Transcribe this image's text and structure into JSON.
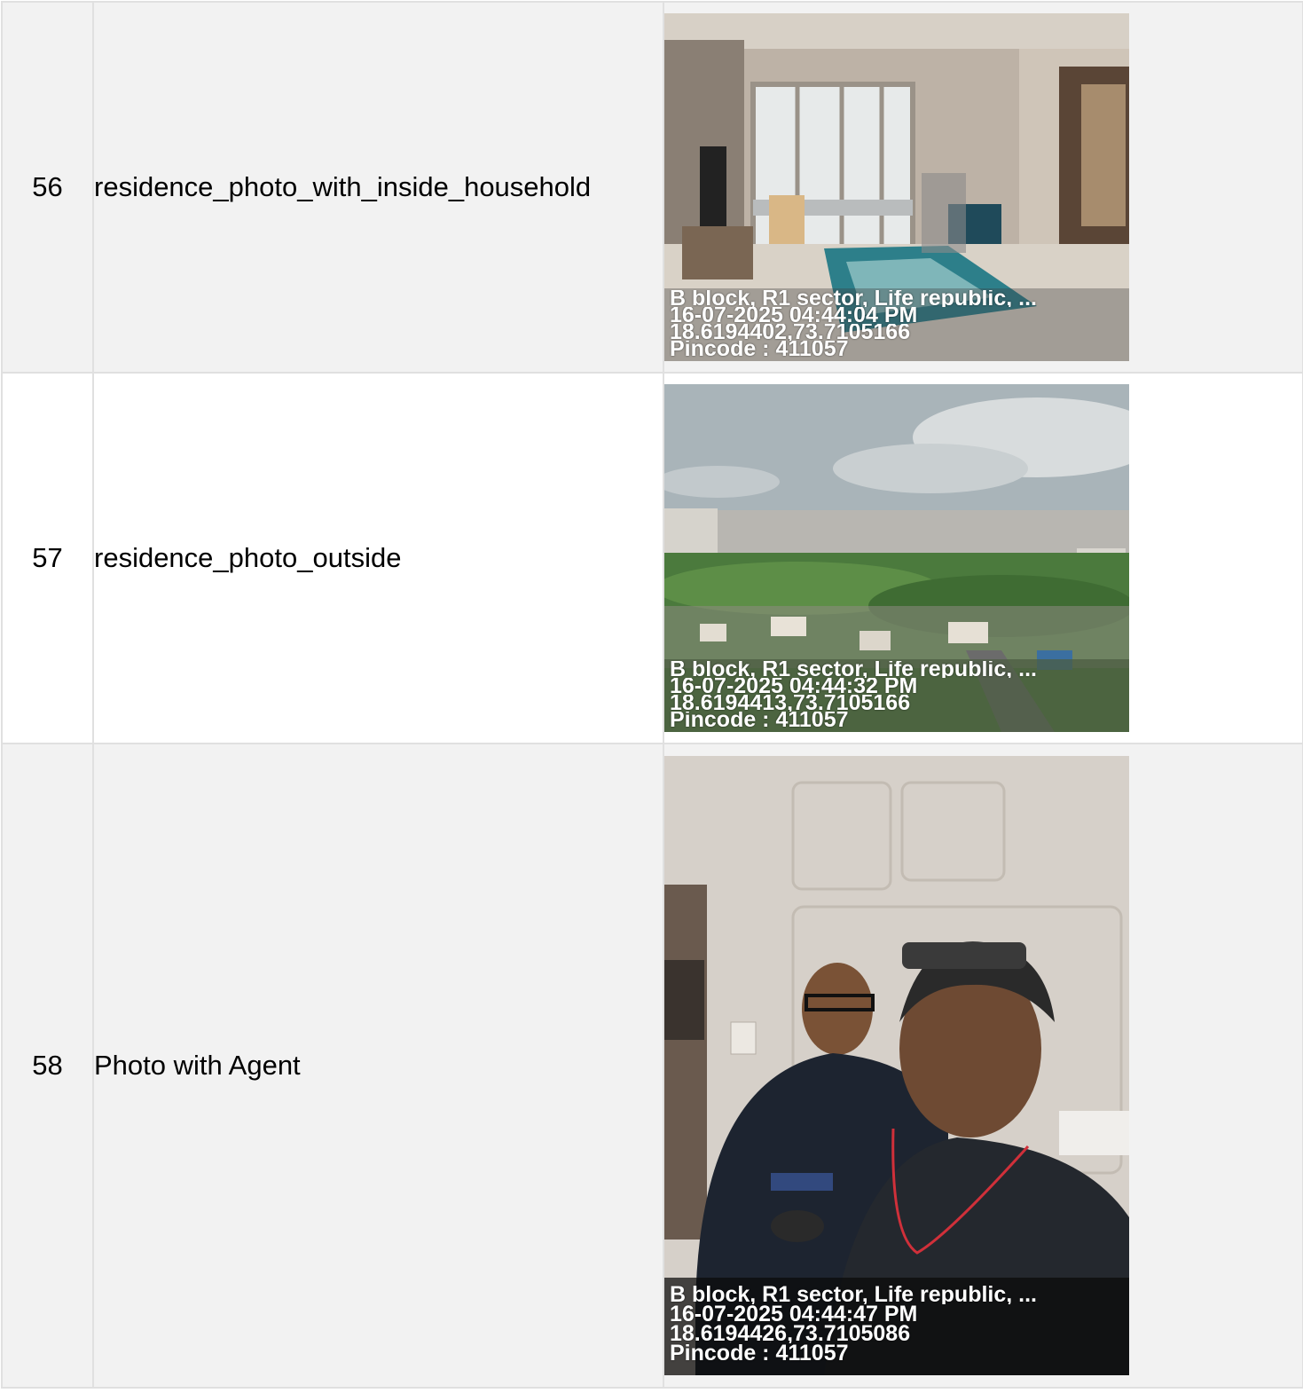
{
  "rows": [
    {
      "index": "56",
      "name": "residence_photo_with_inside_household",
      "photo_icon": "living-room-photo",
      "stamp": {
        "address": "B block, R1 sector, Life republic, ...",
        "datetime": "16-07-2025 04:44:04 PM",
        "coords": "18.6194402,73.7105166",
        "pincode": "Pincode : 411057"
      }
    },
    {
      "index": "57",
      "name": "residence_photo_outside",
      "photo_icon": "city-view-photo",
      "stamp": {
        "address": "B block, R1 sector, Life republic, ...",
        "datetime": "16-07-2025 04:44:32 PM",
        "coords": "18.6194413,73.7105166",
        "pincode": "Pincode : 411057"
      }
    },
    {
      "index": "58",
      "name": "Photo with Agent",
      "photo_icon": "agent-selfie-photo",
      "stamp": {
        "address": "B block, R1 sector, Life republic, ...",
        "datetime": "16-07-2025 04:44:47 PM",
        "coords": "18.6194426,73.7105086",
        "pincode": "Pincode : 411057"
      }
    }
  ],
  "colors": {
    "row_alt": "#f2f2f2",
    "row_plain": "#ffffff",
    "border": "#e0e0e0"
  }
}
